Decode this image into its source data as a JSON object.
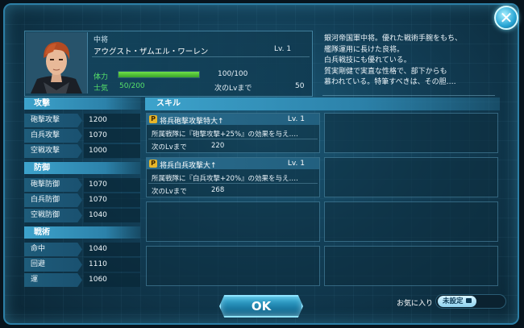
{
  "character": {
    "rank": "中将",
    "name": "アウグスト・ザムエル・ワーレン",
    "level_label": "Lv.  1",
    "hp_label": "体力",
    "hp_value": "100/100",
    "hp_fraction": 1.0,
    "morale_label": "士気",
    "morale_value": "50/200",
    "next_level_label": "次のLvまで",
    "next_level_value": "50",
    "bio_lines": [
      "銀河帝国軍中将。優れた戦術手腕をもち、",
      "艦隊運用に長けた良将。",
      "白兵戦技にも優れている。",
      "質実剛健で実直な性格で、部下からも",
      "慕われている。特筆すべきは、その胆‥‥"
    ]
  },
  "stats": {
    "attack": {
      "title": "攻撃",
      "rows": [
        {
          "name": "砲撃攻撃",
          "value": "1200"
        },
        {
          "name": "白兵攻撃",
          "value": "1070"
        },
        {
          "name": "空戦攻撃",
          "value": "1000"
        }
      ]
    },
    "defense": {
      "title": "防御",
      "rows": [
        {
          "name": "砲撃防御",
          "value": "1070"
        },
        {
          "name": "白兵防御",
          "value": "1070"
        },
        {
          "name": "空戦防御",
          "value": "1040"
        }
      ]
    },
    "tactics": {
      "title": "戦術",
      "rows": [
        {
          "name": "命中",
          "value": "1040"
        },
        {
          "name": "回避",
          "value": "1110"
        },
        {
          "name": "運",
          "value": "1060"
        }
      ]
    }
  },
  "skills": {
    "title": "スキル",
    "items": [
      {
        "badge": "P",
        "name": "将兵砲撃攻撃特大↑",
        "level": "Lv.  1",
        "desc": "所属戦隊に『砲撃攻撃+25%』の効果を与え‥‥",
        "next_label": "次のLvまで",
        "next_value": "220"
      },
      {
        "badge": "P",
        "name": "将兵白兵攻撃大↑",
        "level": "Lv.  1",
        "desc": "所属戦隊に『白兵攻撃+20%』の効果を与え‥‥",
        "next_label": "次のLvまで",
        "next_value": "268"
      }
    ]
  },
  "footer": {
    "ok_label": "OK",
    "favorite_label": "お気に入り",
    "favorite_state": "未設定"
  },
  "icons": {
    "close": "close-icon",
    "lock": "lock-icon",
    "passive": "passive-skill-icon"
  },
  "colors": {
    "accent": "#3da3cc",
    "hp_green": "#56e06a",
    "skill_badge": "#e8b62a"
  }
}
